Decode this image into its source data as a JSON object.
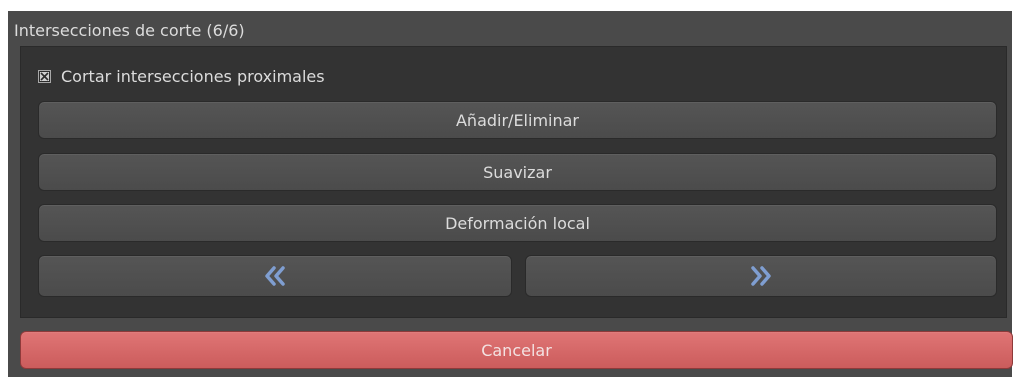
{
  "panel": {
    "title": "Intersecciones de corte (6/6)"
  },
  "options": {
    "cut_proximal_label": "Cortar intersecciones proximales",
    "cut_proximal_checked": true
  },
  "buttons": {
    "add_remove": "Añadir/Eliminar",
    "smooth": "Suavizar",
    "local_deformation": "Deformación local",
    "previous_icon": "double-chevron-left-icon",
    "next_icon": "double-chevron-right-icon",
    "cancel": "Cancelar"
  },
  "colors": {
    "panel_background": "#4a4a4a",
    "group_background": "#333333",
    "button_background": "#505050",
    "text": "#dcdcdc",
    "arrow_accent": "#7f9ed1",
    "cancel_button": "#d66868"
  }
}
